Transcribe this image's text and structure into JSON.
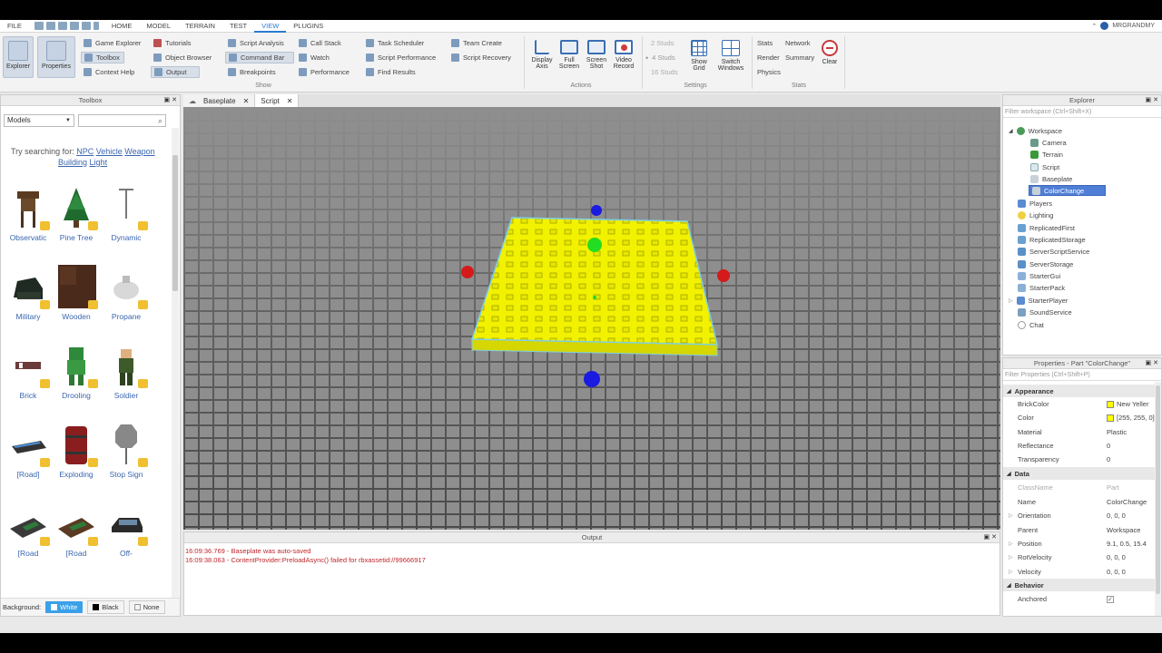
{
  "menu": {
    "tabs": [
      "FILE",
      "HOME",
      "MODEL",
      "TERRAIN",
      "TEST",
      "VIEW",
      "PLUGINS"
    ],
    "active_tab": "VIEW",
    "user_name": "MRGRANDMY"
  },
  "ribbon": {
    "explorer": "Explorer",
    "properties": "Properties",
    "show_items": [
      "Game Explorer",
      "Toolbox",
      "Context Help",
      "Tutorials",
      "Object Browser",
      "Output",
      "Script Analysis",
      "Command Bar",
      "Breakpoints",
      "Call Stack",
      "Watch",
      "Performance",
      "Task Scheduler",
      "Script Performance",
      "Find Results",
      "Team Create",
      "Script Recovery"
    ],
    "show_label": "Show",
    "display_axis": "Display Axis",
    "full_screen": "Full Screen",
    "screen_shot": "Screen Shot",
    "video_record": "Video Record",
    "actions_label": "Actions",
    "studs": [
      "2 Studs",
      "4 Studs",
      "16 Studs"
    ],
    "show_grid": "Show Grid",
    "switch_windows": "Switch Windows",
    "settings_label": "Settings",
    "stats_items": [
      "Stats",
      "Network",
      "Render",
      "Summary",
      "Physics"
    ],
    "clear": "Clear",
    "stats_label": "Stats"
  },
  "toolbox": {
    "title": "Toolbox",
    "category": "Models",
    "search_placeholder": "",
    "try_searching": "Try searching for:",
    "suggestions": [
      "NPC",
      "Vehicle",
      "Weapon",
      "Building",
      "Light"
    ],
    "items": [
      "Observatic",
      "Pine Tree",
      "Dynamic",
      "Military",
      "Wooden",
      "Propane",
      "Brick",
      "Drooling",
      "Soldier",
      "[Road]",
      "Exploding",
      "Stop Sign",
      "[Road",
      "[Road",
      "Off-"
    ],
    "background_label": "Background:",
    "backgrounds": [
      "White",
      "Black",
      "None"
    ]
  },
  "tabs": [
    "Baseplate",
    "Script"
  ],
  "output": {
    "title": "Output",
    "lines": [
      "16:09:36.769 - Baseplate was auto-saved",
      "16:09:38.063 - ContentProvider:PreloadAsync() failed for rbxassetid://99666917"
    ]
  },
  "explorer": {
    "title": "Explorer",
    "filter_placeholder": "Filter workspace (Ctrl+Shift+X)",
    "nodes": [
      "Workspace",
      "Camera",
      "Terrain",
      "Script",
      "Baseplate",
      "ColorChange",
      "Players",
      "Lighting",
      "ReplicatedFirst",
      "ReplicatedStorage",
      "ServerScriptService",
      "ServerStorage",
      "StarterGui",
      "StarterPack",
      "StarterPlayer",
      "SoundService",
      "Chat"
    ]
  },
  "properties": {
    "title": "Properties - Part \"ColorChange\"",
    "filter_placeholder": "Filter Properties (Ctrl+Shift+P)",
    "sections": {
      "appearance": "Appearance",
      "data": "Data",
      "behavior": "Behavior"
    },
    "rows": [
      {
        "name": "BrickColor",
        "value": "New Yeller"
      },
      {
        "name": "Color",
        "value": "[255, 255, 0]"
      },
      {
        "name": "Material",
        "value": "Plastic"
      },
      {
        "name": "Reflectance",
        "value": "0"
      },
      {
        "name": "Transparency",
        "value": "0"
      },
      {
        "name": "ClassName",
        "value": "Part"
      },
      {
        "name": "Name",
        "value": "ColorChange"
      },
      {
        "name": "Orientation",
        "value": "0, 0, 0"
      },
      {
        "name": "Parent",
        "value": "Workspace"
      },
      {
        "name": "Position",
        "value": "9.1, 0.5, 15.4"
      },
      {
        "name": "RotVelocity",
        "value": "0, 0, 0"
      },
      {
        "name": "Velocity",
        "value": "0, 0, 0"
      },
      {
        "name": "Anchored",
        "value": ""
      }
    ]
  },
  "colors": {
    "accent": "#2b7bd3",
    "part": "#ffff00",
    "selection": "#4f7ed6",
    "error_text": "#c0262b"
  }
}
